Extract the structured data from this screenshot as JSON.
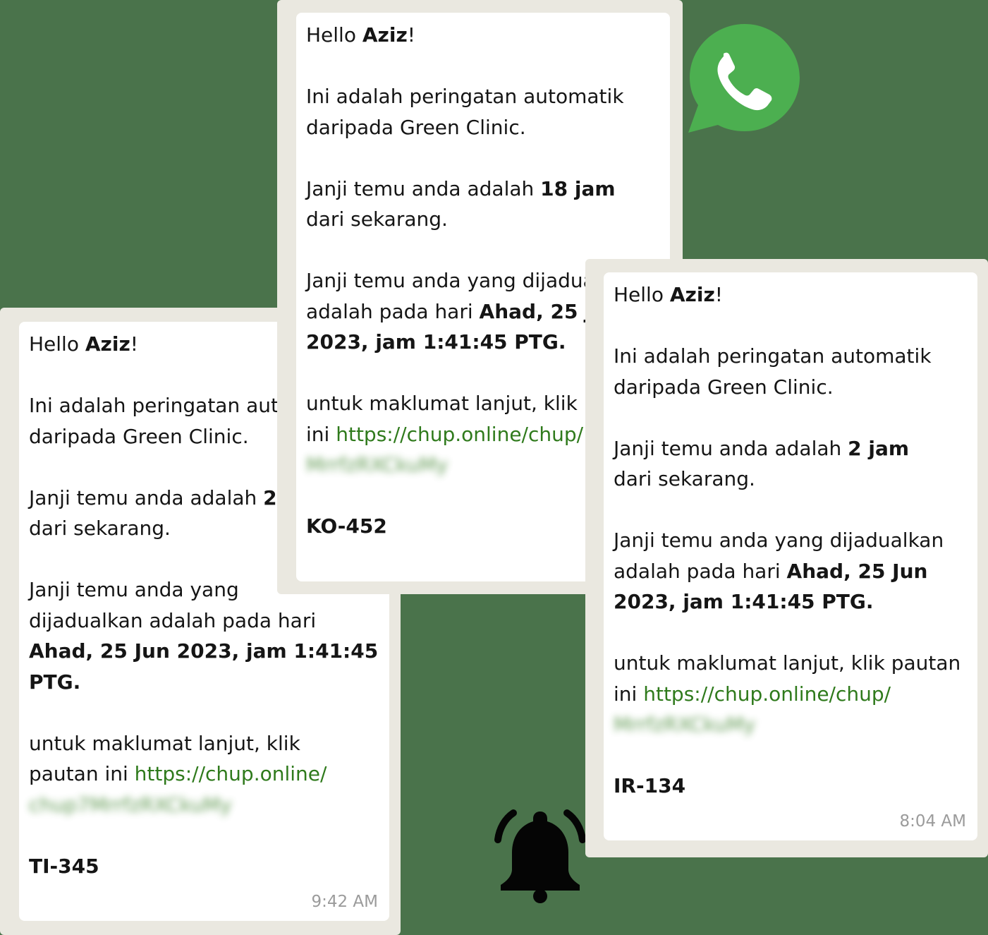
{
  "colors": {
    "background": "#4a734b",
    "frame": "#eae8e0",
    "bubble": "#ffffff",
    "link": "#2f7a1c",
    "whatsapp": "#4caf50"
  },
  "icons": [
    "whatsapp-icon",
    "bell-icon"
  ],
  "messages": [
    {
      "greeting": "Hello ",
      "name": "Aziz",
      "greeting_end": "!",
      "intro_line1": "Ini adalah peringatan automatik",
      "intro_line2": "daripada Green Clinic.",
      "time_prefix": "Janji temu anda adalah ",
      "time_value": "18 jam",
      "time_suffix": "dari sekarang.",
      "sched_line1": "Janji temu anda yang dijadualkan",
      "sched_prefix": "adalah pada hari ",
      "sched_date_a": "Ahad, 25 Jun",
      "sched_date_b": "2023, jam 1:41:45 PTG.",
      "info_line1": "untuk maklumat lanjut, klik pautan",
      "info_prefix": "ini ",
      "link": "https://chup.online/chup/",
      "link_hidden": "MrrfzRXCkuMy",
      "code": "KO-452"
    },
    {
      "greeting": "Hello ",
      "name": "Aziz",
      "greeting_end": "!",
      "intro_line1": "Ini adalah peringatan automatik",
      "intro_line2": "daripada Green Clinic.",
      "time_prefix": "Janji temu anda adalah ",
      "time_value": "2 jam",
      "time_suffix": "dari sekarang.",
      "sched_line1": "Janji temu anda yang dijadualkan",
      "sched_prefix": "adalah pada hari ",
      "sched_date_a": "Ahad, 25 Jun",
      "sched_date_b": "2023, jam 1:41:45 PTG.",
      "info_line1": "untuk maklumat lanjut, klik pautan",
      "info_prefix": "ini ",
      "link": "https://chup.online/chup/",
      "link_hidden": "MrrfzRXCkuMy",
      "code": "IR-134",
      "time": "8:04 AM"
    },
    {
      "greeting": "Hello ",
      "name": "Aziz",
      "greeting_end": "!",
      "intro_line1": "Ini adalah peringatan automatik",
      "intro_line2": "daripada Green Clinic.",
      "time_prefix": "Janji temu anda adalah ",
      "time_value": "24 jam",
      "time_suffix": "dari sekarang.",
      "sched_line1": "Janji temu anda yang",
      "sched_line2": "dijadualkan adalah pada hari",
      "sched_date_a": "Ahad, 25 Jun 2023, jam 1:41:45",
      "sched_date_b": "PTG.",
      "info_line1": "untuk maklumat lanjut, klik",
      "info_prefix": "pautan ini ",
      "link": "https://chup.online/",
      "link_hidden": "chup7MrrfzRXCkuMy",
      "code": "TI-345",
      "time": "9:42 AM"
    }
  ]
}
